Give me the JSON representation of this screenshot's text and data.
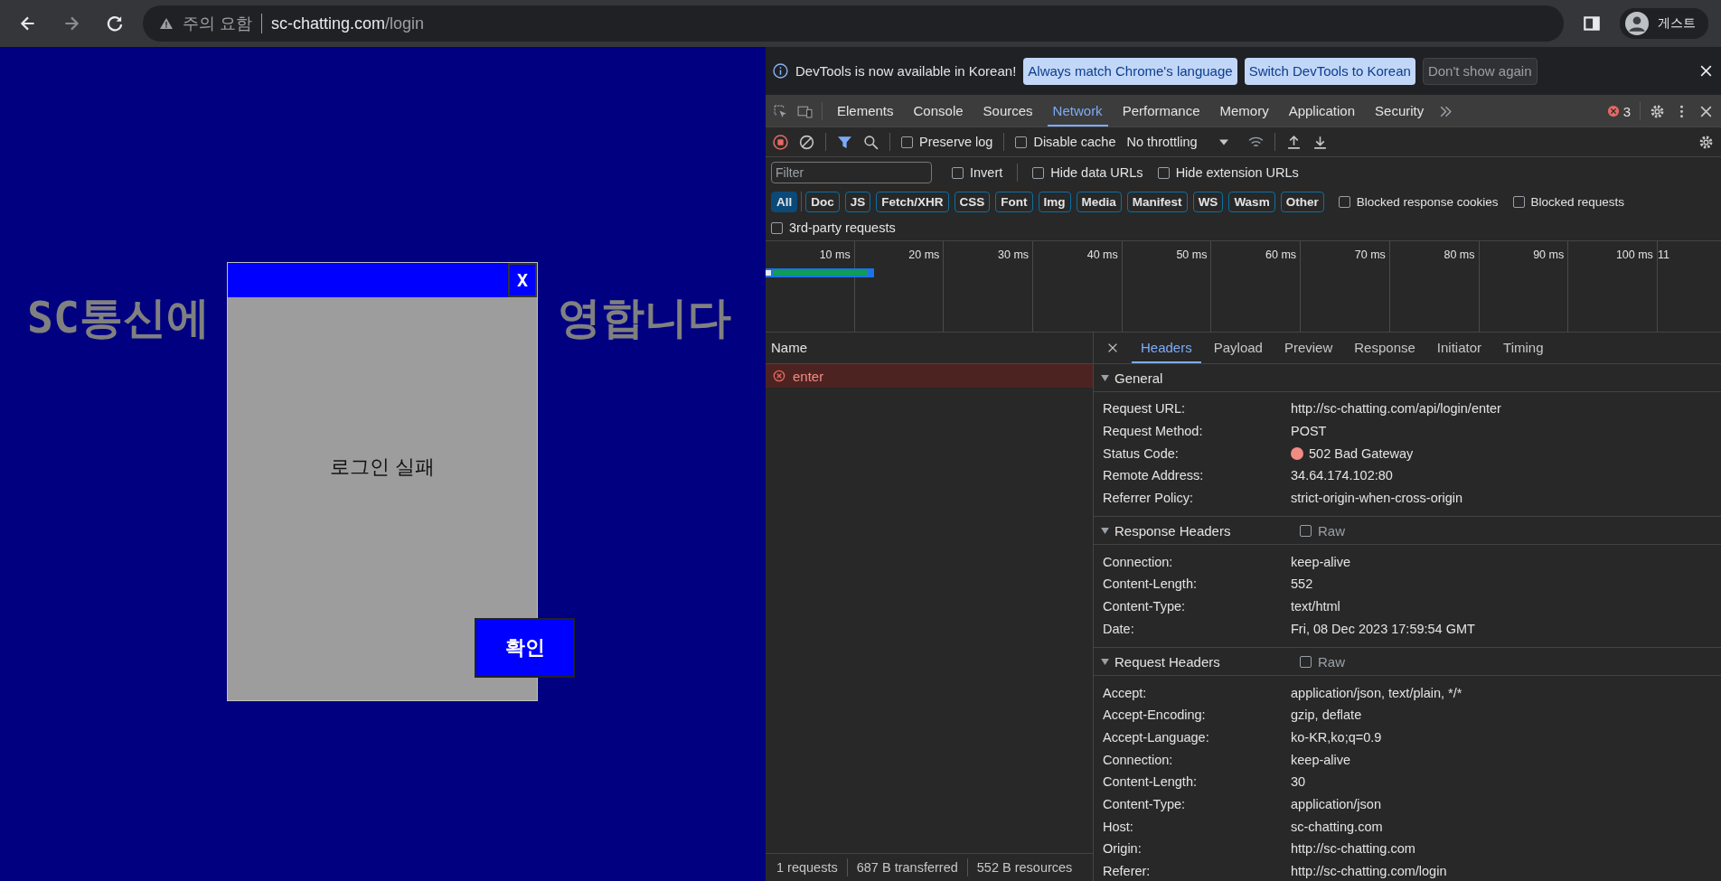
{
  "browser": {
    "security_label": "주의 요함",
    "url_host": "sc-chatting.com",
    "url_path": "/login",
    "profile": "게스트"
  },
  "page": {
    "banner_left": "SC통신에",
    "banner_right": "영합니다",
    "dialog": {
      "close": "X",
      "message": "로그인 실패",
      "confirm": "확인"
    }
  },
  "devtools": {
    "infobar": {
      "message": "DevTools is now available in Korean!",
      "buttons": [
        {
          "label": "Always match Chrome's language",
          "kind": "primary"
        },
        {
          "label": "Switch DevTools to Korean",
          "kind": "primary"
        },
        {
          "label": "Don't show again",
          "kind": "secondary"
        }
      ]
    },
    "tabs": [
      {
        "label": "Elements",
        "selected": false
      },
      {
        "label": "Console",
        "selected": false
      },
      {
        "label": "Sources",
        "selected": false
      },
      {
        "label": "Network",
        "selected": true
      },
      {
        "label": "Performance",
        "selected": false
      },
      {
        "label": "Memory",
        "selected": false
      },
      {
        "label": "Application",
        "selected": false
      },
      {
        "label": "Security",
        "selected": false
      }
    ],
    "error_count": "3",
    "toolbar": {
      "preserve_log": {
        "label": "Preserve log",
        "checked": false
      },
      "disable_cache": {
        "label": "Disable cache",
        "checked": false
      },
      "throttling": "No throttling"
    },
    "filter": {
      "placeholder": "Filter",
      "options": [
        {
          "label": "Invert",
          "checked": false
        },
        {
          "label": "Hide data URLs",
          "checked": false
        },
        {
          "label": "Hide extension URLs",
          "checked": false
        }
      ]
    },
    "types": [
      {
        "label": "All",
        "selected": true
      },
      {
        "label": "Doc",
        "selected": false
      },
      {
        "label": "JS",
        "selected": false
      },
      {
        "label": "Fetch/XHR",
        "selected": false
      },
      {
        "label": "CSS",
        "selected": false
      },
      {
        "label": "Font",
        "selected": false
      },
      {
        "label": "Img",
        "selected": false
      },
      {
        "label": "Media",
        "selected": false
      },
      {
        "label": "Manifest",
        "selected": false
      },
      {
        "label": "WS",
        "selected": false
      },
      {
        "label": "Wasm",
        "selected": false
      },
      {
        "label": "Other",
        "selected": false
      }
    ],
    "type_options": [
      {
        "label": "Blocked response cookies",
        "checked": false
      },
      {
        "label": "Blocked requests",
        "checked": false
      }
    ],
    "third_party": {
      "label": "3rd-party requests",
      "checked": false
    },
    "timeline_ticks": [
      "10 ms",
      "20 ms",
      "30 ms",
      "40 ms",
      "50 ms",
      "60 ms",
      "70 ms",
      "80 ms",
      "90 ms",
      "100 ms",
      "11"
    ],
    "name_header": "Name",
    "requests": [
      {
        "name": "enter",
        "failed": true
      }
    ],
    "status": [
      "1 requests",
      "687 B transferred",
      "552 B resources"
    ],
    "detail_tabs": [
      {
        "label": "Headers",
        "selected": true
      },
      {
        "label": "Payload",
        "selected": false
      },
      {
        "label": "Preview",
        "selected": false
      },
      {
        "label": "Response",
        "selected": false
      },
      {
        "label": "Initiator",
        "selected": false
      },
      {
        "label": "Timing",
        "selected": false
      }
    ],
    "sections": [
      {
        "title": "General",
        "expanded": true,
        "rows": [
          [
            "Request URL:",
            "http://sc-chatting.com/api/login/enter"
          ],
          [
            "Request Method:",
            "POST"
          ],
          {
            "name": "Status Code:",
            "value": "502 Bad Gateway",
            "color": "#f28b82"
          },
          [
            "Remote Address:",
            "34.64.174.102:80"
          ],
          [
            "Referrer Policy:",
            "strict-origin-when-cross-origin"
          ]
        ]
      },
      {
        "title": "Response Headers",
        "expanded": true,
        "raw": {
          "label": "Raw",
          "checked": false
        },
        "rows": [
          [
            "Connection:",
            "keep-alive"
          ],
          [
            "Content-Length:",
            "552"
          ],
          [
            "Content-Type:",
            "text/html"
          ],
          [
            "Date:",
            "Fri, 08 Dec 2023 17:59:54 GMT"
          ]
        ]
      },
      {
        "title": "Request Headers",
        "expanded": true,
        "raw": {
          "label": "Raw",
          "checked": false
        },
        "rows": [
          [
            "Accept:",
            "application/json, text/plain, */*"
          ],
          [
            "Accept-Encoding:",
            "gzip, deflate"
          ],
          [
            "Accept-Language:",
            "ko-KR,ko;q=0.9"
          ],
          [
            "Connection:",
            "keep-alive"
          ],
          [
            "Content-Length:",
            "30"
          ],
          [
            "Content-Type:",
            "application/json"
          ],
          [
            "Host:",
            "sc-chatting.com"
          ],
          [
            "Origin:",
            "http://sc-chatting.com"
          ],
          [
            "Referer:",
            "http://sc-chatting.com/login"
          ]
        ]
      }
    ]
  }
}
